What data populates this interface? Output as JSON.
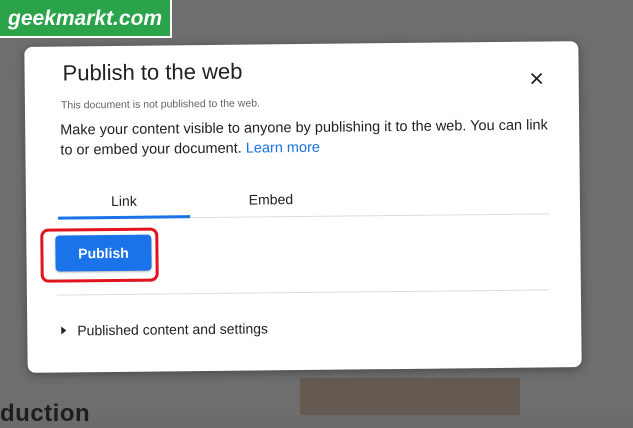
{
  "watermark": {
    "text": "geekmarkt.com"
  },
  "background": {
    "partial_heading": "duction"
  },
  "dialog": {
    "title": "Publish to the web",
    "close_icon": "close-icon",
    "status": "This document is not published to the web.",
    "description": "Make your content visible to anyone by publishing it to the web. You can link to or embed your document.",
    "learn_more": "Learn more",
    "tabs": [
      {
        "label": "Link",
        "selected": true
      },
      {
        "label": "Embed",
        "selected": false
      }
    ],
    "publish_label": "Publish",
    "settings_label": "Published content and settings",
    "settings_icon": "triangle-right-icon"
  },
  "colors": {
    "accent": "#1a73e8",
    "highlight": "#e0131f",
    "watermark_bg": "#2aa34a"
  }
}
